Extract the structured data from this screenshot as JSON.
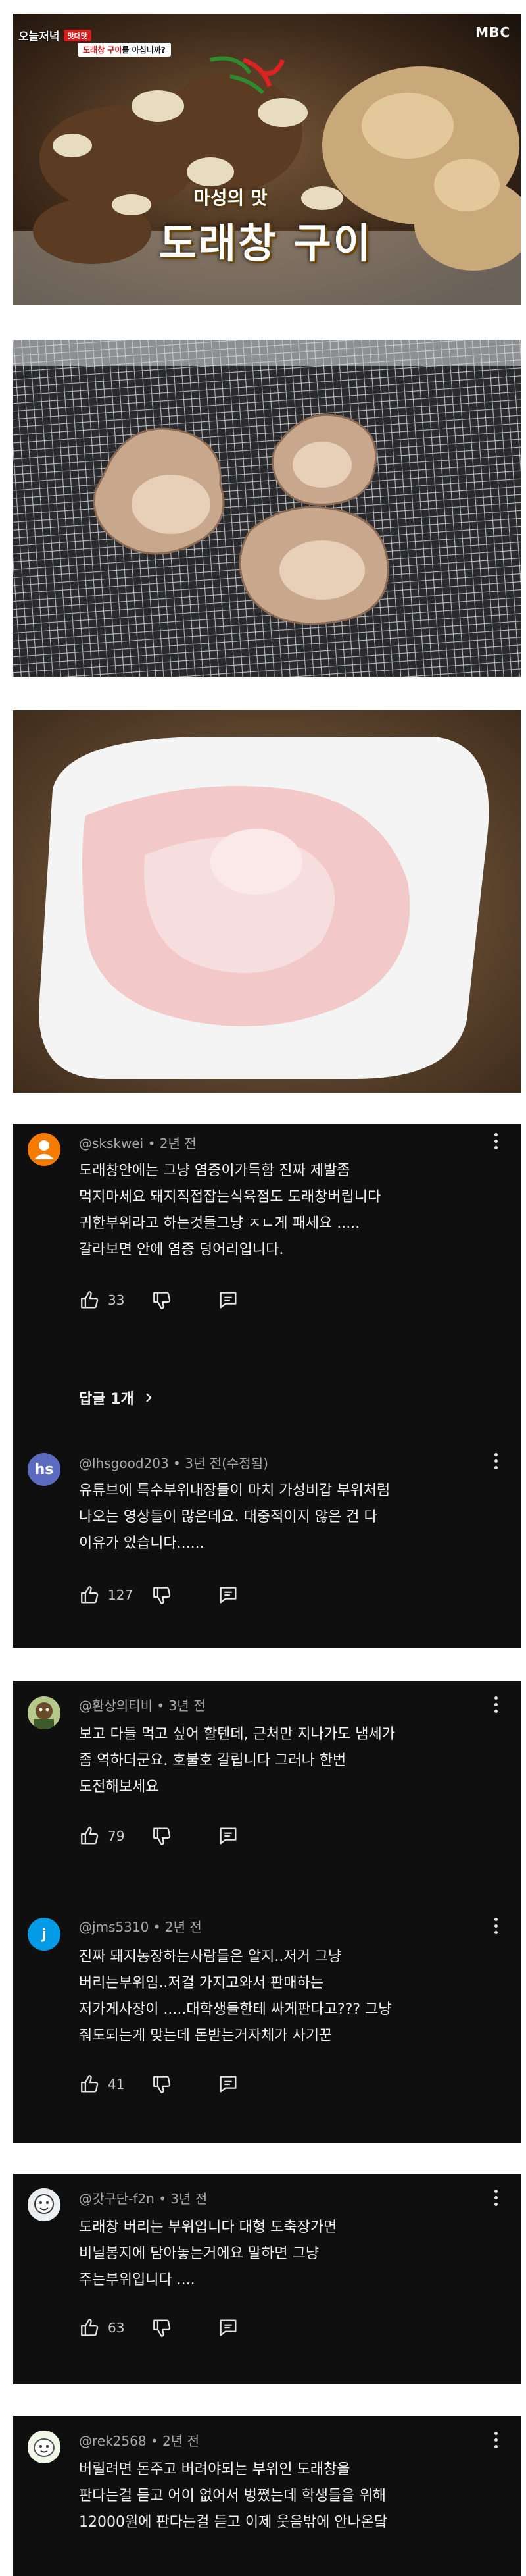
{
  "screenshot_1": {
    "program_title": "오늘저녁",
    "badge": "맛대맛",
    "caption_highlight": "도래창 구이",
    "caption_rest": "를 아십니까?",
    "channel_logo": "MBC",
    "title_small": "마성의 맛",
    "title_big": "도래창 구이"
  },
  "comments": [
    {
      "author": "@skskwei",
      "time": "2년 전",
      "lines": [
        "도래창안에는 그냥 염증이가득함 진짜 제발좀",
        "먹지마세요 돼지직접잡는식육점도 도래창버립니다",
        "귀한부위라고 하는것들그냥 ㅈㄴ게 패세요 .....",
        "갈라보면 안에 염증 덩어리입니다."
      ],
      "likes": "33",
      "replies_label": "답글 1개",
      "avatar_color": "#f57c00",
      "avatar_icon": "person-icon"
    },
    {
      "author": "@lhsgood203",
      "time": "3년 전(수정됨)",
      "lines": [
        "유튜브에 특수부위내장들이 마치 가성비갑 부위처럼",
        "나오는 영상들이 많은데요.  대중적이지 않은 건 다",
        "이유가 있습니다......"
      ],
      "likes": "127",
      "avatar_color": "#5c6bc0",
      "avatar_text": "hs"
    },
    {
      "author": "@환상의티비",
      "time": "3년 전",
      "lines": [
        "보고 다들 먹고 싶어 할텐데, 근처만 지나가도 냄세가",
        "좀 역하더군요. 호불호 갈립니다 그러나 한번",
        "도전해보세요"
      ],
      "likes": "79",
      "avatar_color": "#8aa05c",
      "avatar_icon": "character-icon"
    },
    {
      "author": "@jms5310",
      "time": "2년 전",
      "lines": [
        "진짜 돼지농장하는사람들은 알지..저거 그냥",
        "버리는부위임..저걸 가지고와서 판매하는",
        "저가게사장이 .....대학생들한테 싸게판다고???  그냥",
        "줘도되는게 맞는데 돈받는거자체가 사기꾼"
      ],
      "likes": "41",
      "avatar_color": "#039be5",
      "avatar_text": "j"
    },
    {
      "author": "@갓구단-f2n",
      "time": "3년 전",
      "lines": [
        "도래창 버리는 부위입니다 대형 도축장가면",
        "비닐봉지에 담아놓는거에요 말하면 그냥",
        "주는부위입니다 ...."
      ],
      "likes": "63",
      "avatar_color": "#cfd8dc",
      "avatar_icon": "cartoon-icon"
    },
    {
      "author": "@rek2568",
      "time": "2년 전",
      "lines": [
        "버릴려면 돈주고 버려야되는 부위인 도래창을",
        "판다는걸 듣고 어이 없어서 벙쪘는데 학생들을 위해",
        "12000원에 판다는걸 듣고 이제 웃음밖에 안나온닼"
      ],
      "avatar_color": "#e8f0e0",
      "avatar_icon": "cartoon-icon"
    }
  ],
  "colors": {
    "card_bg": "#0f0f0f",
    "text": "#f1f1f1",
    "meta": "#aaaaaa"
  }
}
